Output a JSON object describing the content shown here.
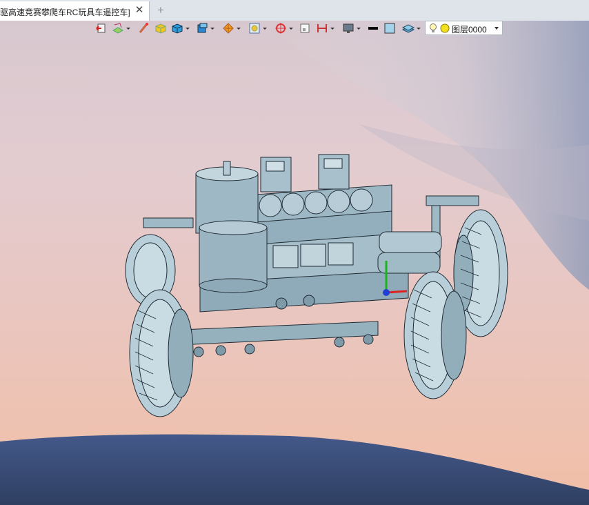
{
  "tab": {
    "title": "驱高速竞赛攀爬车RC玩具车遥控车]",
    "close_glyph": "✕",
    "add_glyph": "+"
  },
  "toolbar": {
    "layer_selector": {
      "value": "图层0000"
    },
    "icons": [
      "exit-sketch-icon",
      "render-style-icon",
      "paint-brush-icon",
      "solid-yellow-icon",
      "solid-blue-icon",
      "view-cube-icon",
      "filter-icon",
      "snap-icon",
      "origin-icon",
      "frame-icon",
      "dimension-icon",
      "display-icon",
      "line-color-icon",
      "face-color-icon",
      "layer-manager-icon",
      "bulb-icon",
      "sun-icon"
    ]
  },
  "colors": {
    "model_fill": "#a9c3cf",
    "model_stroke": "#1e2a33",
    "ground": "#3e5279",
    "sky_top": "#d7c8cf",
    "sky_bottom": "#f1bca6"
  }
}
